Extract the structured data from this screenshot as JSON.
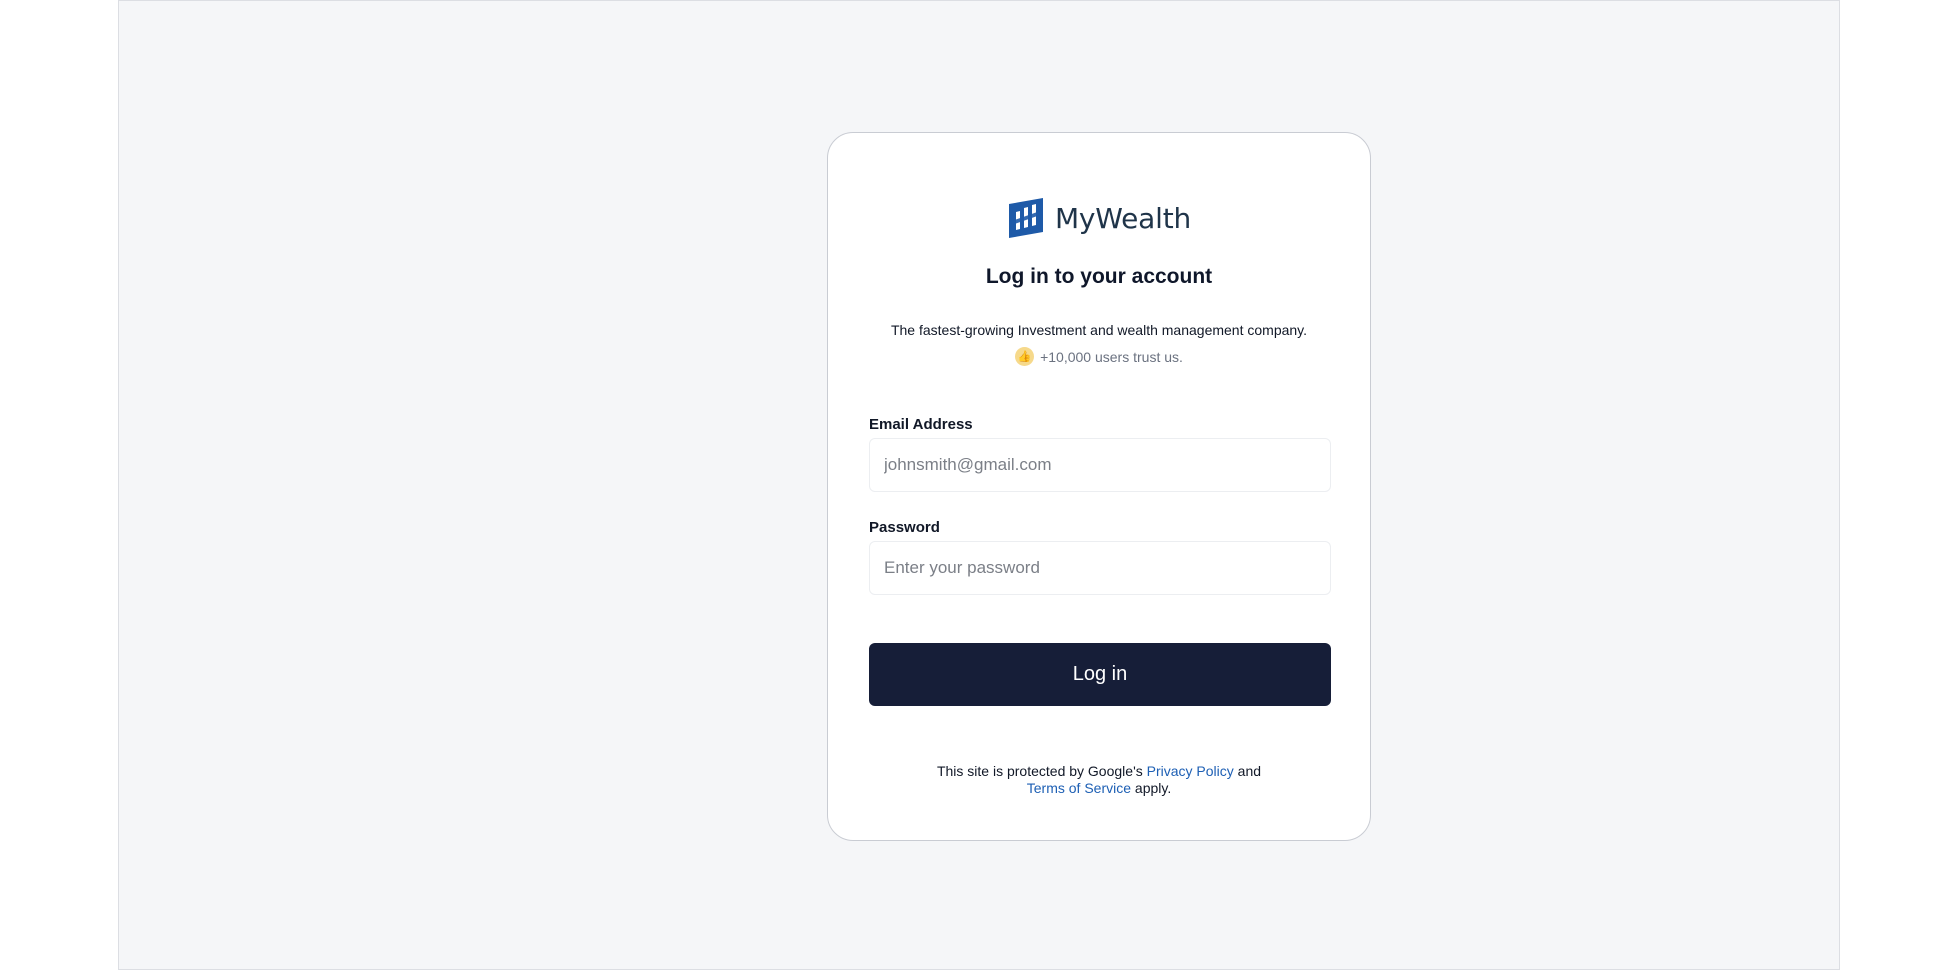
{
  "brand": {
    "name": "MyWealth",
    "logo_icon": "mywealth-logo-icon",
    "color": "#1f3449"
  },
  "login": {
    "title": "Log in to your account",
    "subtitle": "The fastest-growing Investment and wealth management company.",
    "trust_icon": "thumbs-up-icon",
    "trust_text": "+10,000 users trust us."
  },
  "form": {
    "email_label": "Email Address",
    "email_placeholder": "johnsmith@gmail.com",
    "email_value": "",
    "password_label": "Password",
    "password_placeholder": "Enter your password",
    "password_value": "",
    "submit_label": "Log in"
  },
  "legal": {
    "prefix": "This site is protected by Google's",
    "privacy_link": "Privacy Policy",
    "conjunction": "and",
    "terms_link": "Terms of Service",
    "suffix": "apply."
  },
  "colors": {
    "page_background": "#f5f6f8",
    "card_background": "#ffffff",
    "button_background": "#161e38",
    "link": "#1d5fb4"
  }
}
